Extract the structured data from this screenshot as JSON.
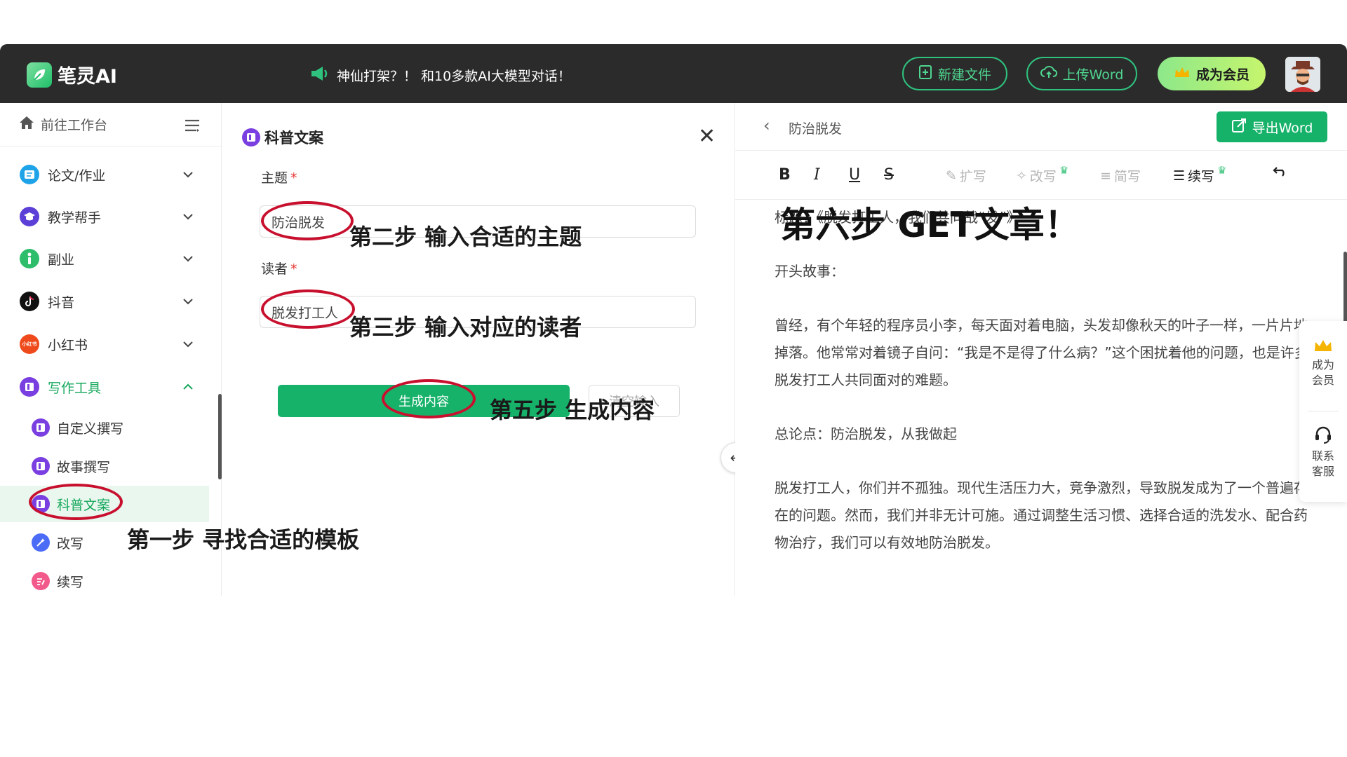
{
  "app": {
    "logo_text": "笔灵AI",
    "announcement": "神仙打架？！ 和10多款AI大模型对话！",
    "new_file": "新建文件",
    "upload_word": "上传Word",
    "become_vip": "成为会员"
  },
  "sidebar": {
    "workbench": "前往工作台",
    "items": [
      {
        "label": "论文/作业",
        "icon": "paper-icon",
        "color": "#1fa3e8"
      },
      {
        "label": "教学帮手",
        "icon": "graduation-icon",
        "color": "#5b3fd6"
      },
      {
        "label": "副业",
        "icon": "info-icon",
        "color": "#2ebd6b"
      },
      {
        "label": "抖音",
        "icon": "tiktok-icon",
        "color": "#111111"
      },
      {
        "label": "小红书",
        "icon": "xiaohongshu-icon",
        "color": "#ef4a1b",
        "icon_text": "小红书"
      },
      {
        "label": "写作工具",
        "icon": "pen-tool-icon",
        "color": "#7a3fe0"
      }
    ],
    "sub_items": [
      {
        "label": "自定义撰写"
      },
      {
        "label": "故事撰写"
      },
      {
        "label": "科普文案"
      },
      {
        "label": "改写"
      },
      {
        "label": "续写"
      }
    ]
  },
  "form": {
    "title": "科普文案",
    "topic_label": "主题",
    "topic_value": "防治脱发",
    "reader_label": "读者",
    "reader_value": "脱发打工人",
    "required_mark": "*",
    "generate": "生成内容",
    "clear": "清空输入"
  },
  "editor": {
    "doc_name": "防治脱发",
    "export": "导出Word",
    "toolbar": {
      "bold": "B",
      "italic": "I",
      "underline": "U",
      "strike": "S",
      "expand": "扩写",
      "rewrite": "改写",
      "simplify": "简写",
      "continue": "续写"
    },
    "paragraphs": [
      "标题：《脱发打工人，我们共同战“发”》",
      "开头故事：",
      "曾经，有个年轻的程序员小李，每天面对着电脑，头发却像秋天的叶子一样，一片片地掉落。他常常对着镜子自问：“我是不是得了什么病？”这个困扰着他的问题，也是许多脱发打工人共同面对的难题。",
      "总论点：防治脱发，从我做起",
      "脱发打工人，你们并不孤独。现代生活压力大，竞争激烈，导致脱发成为了一个普遍存在的问题。然而，我们并非无计可施。通过调整生活习惯、选择合适的洗发水、配合药物治疗，我们可以有效地防治脱发。"
    ]
  },
  "float": {
    "vip_line1": "成为",
    "vip_line2": "会员",
    "service_line1": "联系",
    "service_line2": "客服"
  },
  "annotations": {
    "step1": "第一步 寻找合适的模板",
    "step2": "第二步 输入合适的主题",
    "step3": "第三步 输入对应的读者",
    "step5": "第五步 生成内容",
    "step6": "第六步 GET文章！"
  },
  "colors": {
    "brand_green": "#17b26a",
    "topbar": "#2b2b2b",
    "annotation_ring": "#c8102e"
  }
}
